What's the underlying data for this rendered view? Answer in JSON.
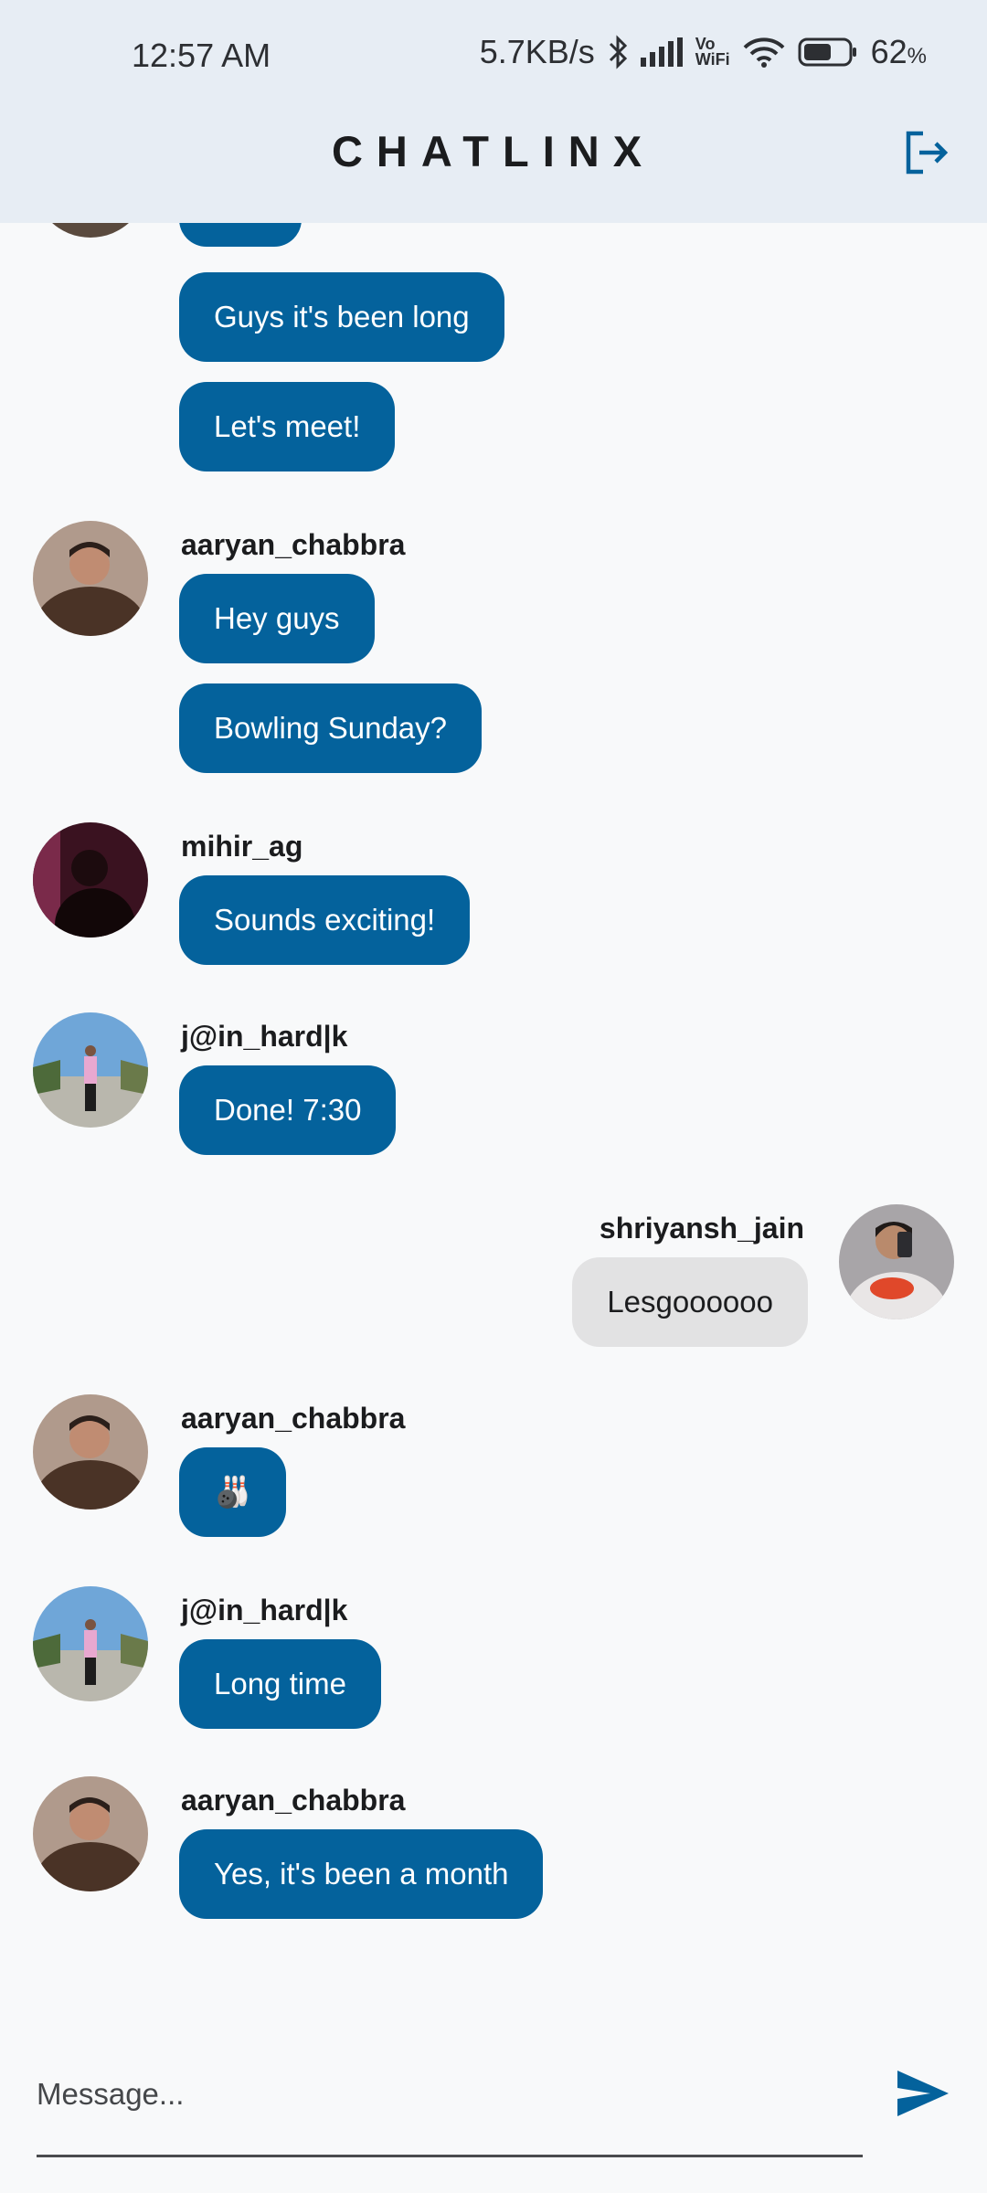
{
  "status_bar": {
    "time": "12:57 AM",
    "net_speed": "5.7KB/s",
    "vowifi_top": "Vo",
    "vowifi_bottom": "WiFi",
    "battery": "62",
    "battery_unit": "%",
    "battery_level": 0.62
  },
  "app": {
    "title": "CHATLINX",
    "logout_icon": "logout-icon",
    "accent": "#04629c"
  },
  "messages": [
    {
      "text": "Guys it's been long"
    },
    {
      "text": "Let's meet!"
    },
    {
      "user": "aaryan_chabbra",
      "text": "Hey guys"
    },
    {
      "text": "Bowling Sunday?"
    },
    {
      "user": "mihir_ag",
      "text": "Sounds exciting!"
    },
    {
      "user": "j@in_hard|k",
      "text": "Done! 7:30"
    },
    {
      "user": "shriyansh_jain",
      "text": "Lesgoooooo"
    },
    {
      "user": "aaryan_chabbra",
      "text": "🎳"
    },
    {
      "user": "j@in_hard|k",
      "text": "Long time"
    },
    {
      "user": "aaryan_chabbra",
      "text": "Yes, it's been a month"
    }
  ],
  "composer": {
    "placeholder": "Message...",
    "send_icon": "send-icon"
  }
}
